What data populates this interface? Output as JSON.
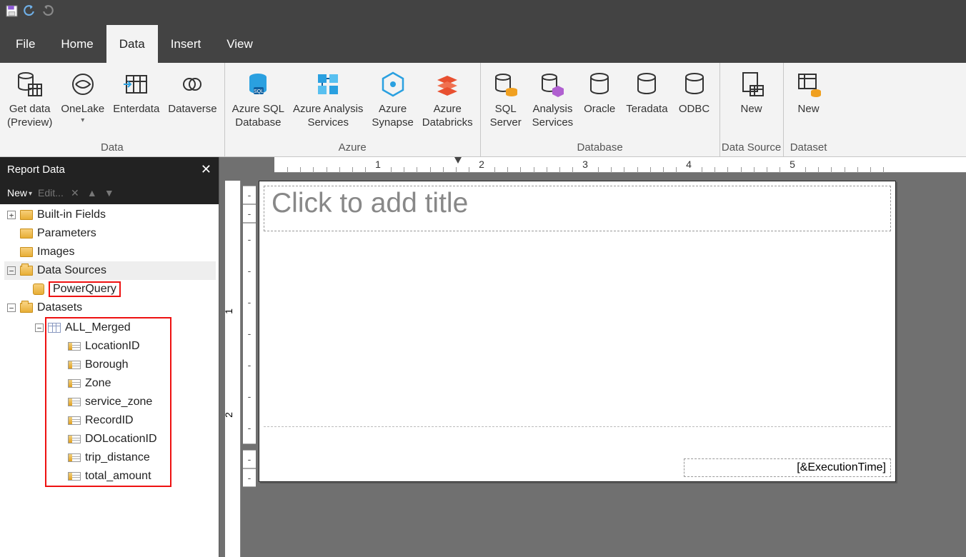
{
  "titlebar": {
    "icons": [
      "save",
      "undo",
      "redo"
    ]
  },
  "menu": {
    "tabs": [
      "File",
      "Home",
      "Data",
      "Insert",
      "View"
    ],
    "active": 2
  },
  "ribbon": {
    "groups": [
      {
        "label": "Data",
        "buttons": [
          {
            "name": "get-data",
            "label": "Get data\n(Preview)"
          },
          {
            "name": "onelake",
            "label": "OneLake",
            "dropdown": true
          },
          {
            "name": "enterdata",
            "label": "Enterdata"
          },
          {
            "name": "dataverse",
            "label": "Dataverse"
          }
        ]
      },
      {
        "label": "Azure",
        "buttons": [
          {
            "name": "azure-sql-database",
            "label": "Azure SQL\nDatabase"
          },
          {
            "name": "azure-analysis-services",
            "label": "Azure Analysis\nServices"
          },
          {
            "name": "azure-synapse",
            "label": "Azure\nSynapse"
          },
          {
            "name": "azure-databricks",
            "label": "Azure\nDatabricks"
          }
        ]
      },
      {
        "label": "Database",
        "buttons": [
          {
            "name": "sql-server",
            "label": "SQL\nServer"
          },
          {
            "name": "analysis-services",
            "label": "Analysis\nServices"
          },
          {
            "name": "oracle",
            "label": "Oracle"
          },
          {
            "name": "teradata",
            "label": "Teradata"
          },
          {
            "name": "odbc",
            "label": "ODBC"
          }
        ]
      },
      {
        "label": "Data Source",
        "buttons": [
          {
            "name": "new-data-source",
            "label": "New"
          }
        ]
      },
      {
        "label": "Dataset",
        "buttons": [
          {
            "name": "new-dataset",
            "label": "New"
          }
        ]
      }
    ]
  },
  "report_data": {
    "panel_title": "Report Data",
    "toolbar": {
      "new": "New",
      "edit": "Edit..."
    },
    "tree": {
      "builtin_fields": "Built-in Fields",
      "parameters": "Parameters",
      "images": "Images",
      "data_sources": {
        "label": "Data Sources",
        "items": [
          "PowerQuery"
        ]
      },
      "datasets": {
        "label": "Datasets",
        "items": [
          {
            "name": "ALL_Merged",
            "fields": [
              "LocationID",
              "Borough",
              "Zone",
              "service_zone",
              "RecordID",
              "DOLocationID",
              "trip_distance",
              "total_amount"
            ]
          }
        ]
      }
    }
  },
  "canvas": {
    "title_placeholder": "Click to add title",
    "footer_expression": "[&ExecutionTime]",
    "ruler_inches": [
      1,
      2,
      3,
      4,
      5
    ],
    "vruler_inches": [
      1,
      2
    ]
  }
}
